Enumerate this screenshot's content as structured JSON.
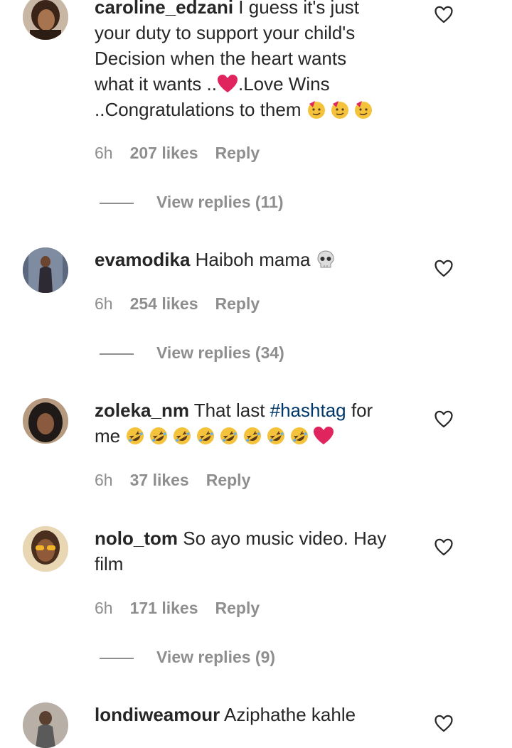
{
  "comments": [
    {
      "username": "caroline_edzani",
      "text_lines": [
        " I guess it's just",
        "your duty to support your child's",
        "Decision when the heart wants",
        "what it wants ..",
        ".Love Wins",
        "..Congratulations to them "
      ],
      "time": "6h",
      "likes": "207 likes",
      "reply": "Reply",
      "view_replies": "View replies (11)",
      "avatar_colors": [
        "#4a3226",
        "#c99c7c"
      ]
    },
    {
      "username": "evamodika",
      "text": " Haiboh mama ",
      "time": "6h",
      "likes": "254 likes",
      "reply": "Reply",
      "view_replies": "View replies (34)",
      "avatar_colors": [
        "#6d7a8f",
        "#2a2f3a"
      ]
    },
    {
      "username": "zoleka_nm",
      "text_before": " That last ",
      "hashtag": "#hashtag",
      "text_after": " for",
      "text_line2": "me ",
      "time": "6h",
      "likes": "37 likes",
      "reply": "Reply",
      "avatar_colors": [
        "#1f1a17",
        "#9a6a4e"
      ]
    },
    {
      "username": "nolo_tom",
      "text": " So ayo music video. Hay",
      "text_line2": "film",
      "time": "6h",
      "likes": "171 likes",
      "reply": "Reply",
      "view_replies": "View replies (9)",
      "avatar_colors": [
        "#e8b23a",
        "#6b3f2a"
      ]
    },
    {
      "username": "londiweamour",
      "text": " Aziphathe kahle",
      "avatar_colors": [
        "#5a5a5a",
        "#b8b0a6"
      ]
    }
  ],
  "colors": {
    "text": "#262626",
    "meta": "#8e8e8e",
    "hashtag": "#00376b",
    "heart": "#e0245e"
  },
  "icons": {
    "like": "heart-outline-icon",
    "party": "partying-face-emoji",
    "skull": "skull-emoji",
    "laugh": "rolling-on-floor-laughing-emoji",
    "heart": "red-heart-emoji"
  }
}
